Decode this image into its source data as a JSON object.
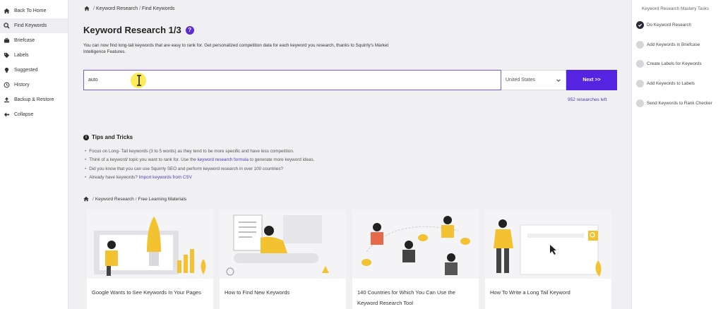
{
  "sidebar": {
    "items": [
      {
        "label": "Back To Home",
        "icon": "home-icon",
        "active": false
      },
      {
        "label": "Find Keywords",
        "icon": "search-icon",
        "active": true
      },
      {
        "label": "Briefcase",
        "icon": "briefcase-icon",
        "active": false
      },
      {
        "label": "Labels",
        "icon": "tag-icon",
        "active": false
      },
      {
        "label": "Suggested",
        "icon": "lightbulb-icon",
        "active": false
      },
      {
        "label": "History",
        "icon": "history-icon",
        "active": false
      },
      {
        "label": "Backup & Restore",
        "icon": "upload-icon",
        "active": false
      },
      {
        "label": "Collapse",
        "icon": "arrow-left-icon",
        "active": false
      }
    ]
  },
  "breadcrumb": {
    "first": "Keyword Research",
    "sep": "/",
    "second": "Find Keywords"
  },
  "title": {
    "text": "Keyword Research 1/3",
    "help": "?"
  },
  "intro": "You can now find long-tail keywords that are easy to rank for. Get personalized competition data for each keyword you research, thanks to Squirrly's Market Intelligence Features.",
  "search": {
    "value": "auto",
    "placeholder": "",
    "country": "United States",
    "next_label": "Next >>",
    "researches_left": "952 researches left"
  },
  "tips": {
    "title": "Tips and Tricks",
    "items": {
      "t1": "Focus on Long- Tail keywords (3 to 5 words) as they tend to be more specific and have less competition.",
      "t2_pre": "Think of a keyword/ topic you want to rank for. Use the ",
      "t2_link": "keyword research formula",
      "t2_post": " to generate more keyword ideas.",
      "t3": "Did you know that you can use Squirrly SEO and perform keyword research in over 100 countries?",
      "t4_pre": "Already have keywords? ",
      "t4_link": "Import keywords from CSV"
    }
  },
  "learning": {
    "breadcrumb_first": "Keyword Research",
    "sep": "/",
    "breadcrumb_second": "Free Learning Materials",
    "cards": [
      {
        "title": "Google Wants to See Keywords In Your Pages"
      },
      {
        "title": "How to Find New Keywords"
      },
      {
        "title": "140 Countries for Which You Can Use the Keyword Research Tool"
      },
      {
        "title": "How To Write a Long Tail Keyword"
      }
    ]
  },
  "tasks": {
    "title": "Keyword Research Mastery Tasks",
    "items": [
      {
        "label": "Do Keyword Research",
        "done": true
      },
      {
        "label": "Add Keywords in Briefcase",
        "done": false
      },
      {
        "label": "Create Labels for Keywords",
        "done": false
      },
      {
        "label": "Add Keywords to Labels",
        "done": false
      },
      {
        "label": "Send Keywords to Rank Checker",
        "done": false
      }
    ]
  },
  "colors": {
    "accent": "#5524e0",
    "link": "#4a3bb5",
    "illustration_yellow": "#f2c230"
  }
}
